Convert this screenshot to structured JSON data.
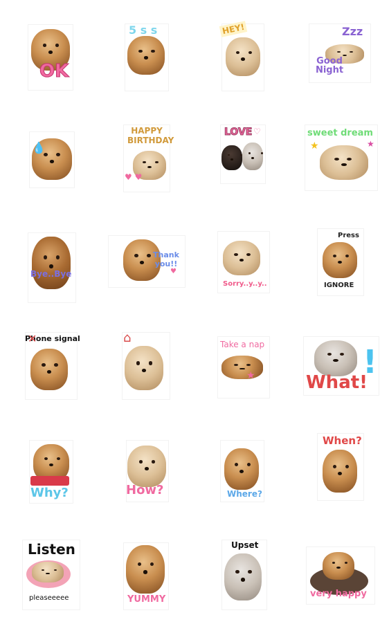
{
  "stickers": [
    {
      "caption": "OK",
      "color": "#f06aa0"
    },
    {
      "caption": "5 s s",
      "color": "#7fd6ec"
    },
    {
      "caption": "HEY!",
      "color": "#e0a12a"
    },
    {
      "caption": "Good Night",
      "color": "#8a63d2"
    },
    {
      "caption": "",
      "color": "#5cc6e8"
    },
    {
      "caption": "HAPPY BIRTHDAY",
      "color": "#d19a3b"
    },
    {
      "caption": "LOVE",
      "color": "#f06aa0"
    },
    {
      "caption": "sweet dream",
      "color": "#6fdc77"
    },
    {
      "caption": "Bye..Bye",
      "color": "#7a6fe0"
    },
    {
      "caption": "Thank you!!",
      "color": "#6a8ce8"
    },
    {
      "caption": "Sorry..y..y..",
      "color": "#f05a8a"
    },
    {
      "caption": "Press",
      "color": "#222222"
    },
    {
      "caption": "Phone signal",
      "color": "#111111"
    },
    {
      "caption": "",
      "color": "#d94b4b"
    },
    {
      "caption": "Take a nap",
      "color": "#f06aa0"
    },
    {
      "caption": "What!",
      "color": "#e04848"
    },
    {
      "caption": "Why?",
      "color": "#5cc6e8"
    },
    {
      "caption": "How?",
      "color": "#f06aa0"
    },
    {
      "caption": "Where?",
      "color": "#5ca8e8"
    },
    {
      "caption": "When?",
      "color": "#e04848"
    },
    {
      "caption": "Listen",
      "color": "#111111"
    },
    {
      "caption": "YUMMY",
      "color": "#f06aa0"
    },
    {
      "caption": "Upset",
      "color": "#111111"
    },
    {
      "caption": "very happy",
      "color": "#f06aa0"
    }
  ],
  "extra": {
    "ignore_label": "IGNORE",
    "please_label": "pleaseeeee",
    "what_mark": "!",
    "how_mark": "?",
    "where_mark": "?",
    "when_mark": "?",
    "why_mark": "?"
  }
}
